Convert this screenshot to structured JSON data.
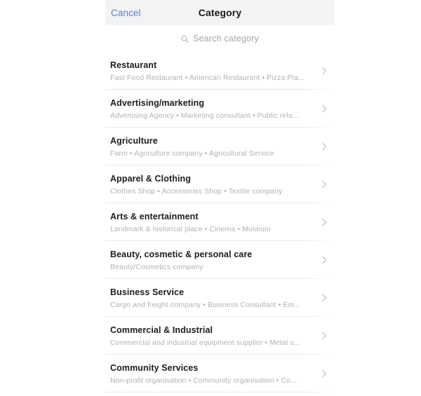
{
  "header": {
    "cancel_label": "Cancel",
    "title": "Category"
  },
  "search": {
    "icon": "search-icon",
    "placeholder": "Search category",
    "value": ""
  },
  "colors": {
    "cancel_blue": "#5b7fc7",
    "header_bg": "#f2f3f5",
    "title_text": "#1c1c1e",
    "subtitle_text": "#b0b3b8",
    "divider": "#e8e9eb",
    "chevron": "#c5c7cb"
  },
  "list": {
    "chevron_icon": "chevron-right-icon",
    "items": [
      {
        "title": "Restaurant",
        "subtitle": "Fast Food Restaurant • American Restaurant • Pizza Pla..."
      },
      {
        "title": "Advertising/marketing",
        "subtitle": "Advertising Agency • Marketing consultant • Public rela..."
      },
      {
        "title": "Agriculture",
        "subtitle": "Farm • Agriculture company • Agricultural Service"
      },
      {
        "title": "Apparel & Clothing",
        "subtitle": "Clothes Shop • Accessories Shop • Textile company"
      },
      {
        "title": "Arts & entertainment",
        "subtitle": "Landmark & historical place • Cinema • Museum"
      },
      {
        "title": "Beauty, cosmetic & personal care",
        "subtitle": "Beauty/Cosmetics company"
      },
      {
        "title": "Business Service",
        "subtitle": "Cargo and freight company • Business Consultant • Em..."
      },
      {
        "title": "Commercial & Industrial",
        "subtitle": "Commercial and industrial equipment supplier • Metal s..."
      },
      {
        "title": "Community Services",
        "subtitle": "Non-profit organisation • Community organisation • Co..."
      }
    ]
  }
}
